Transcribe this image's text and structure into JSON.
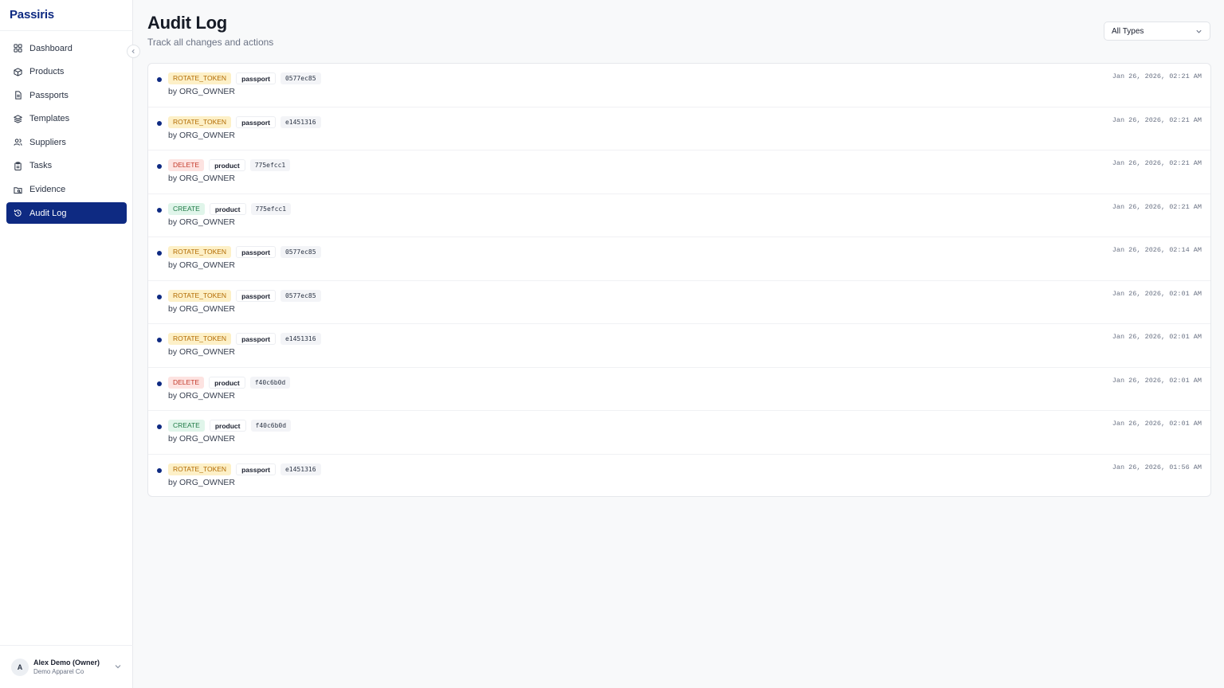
{
  "brand": {
    "logo": "Passiris"
  },
  "sidebar": {
    "items": [
      {
        "label": "Dashboard",
        "icon": "dashboard-icon",
        "active": false
      },
      {
        "label": "Products",
        "icon": "box-icon",
        "active": false
      },
      {
        "label": "Passports",
        "icon": "file-icon",
        "active": false
      },
      {
        "label": "Templates",
        "icon": "layers-icon",
        "active": false
      },
      {
        "label": "Suppliers",
        "icon": "users-icon",
        "active": false
      },
      {
        "label": "Tasks",
        "icon": "clipboard-icon",
        "active": false
      },
      {
        "label": "Evidence",
        "icon": "folder-icon",
        "active": false
      },
      {
        "label": "Audit Log",
        "icon": "history-icon",
        "active": true
      }
    ],
    "user": {
      "initial": "A",
      "name": "Alex Demo (Owner)",
      "org": "Demo Apparel Co"
    }
  },
  "header": {
    "title": "Audit Log",
    "subtitle": "Track all changes and actions",
    "filter": {
      "selected": "All Types"
    }
  },
  "colors": {
    "accent": "#0e2a82",
    "rotate_bg": "#fdf0c7",
    "delete_bg": "#fde3e1",
    "create_bg": "#e0f5ea"
  },
  "log": {
    "entries": [
      {
        "action": "ROTATE_TOKEN",
        "entity": "passport",
        "id": "0577ec85",
        "by": "by ORG_OWNER",
        "time": "Jan 26, 2026, 02:21 AM"
      },
      {
        "action": "ROTATE_TOKEN",
        "entity": "passport",
        "id": "e1451316",
        "by": "by ORG_OWNER",
        "time": "Jan 26, 2026, 02:21 AM"
      },
      {
        "action": "DELETE",
        "entity": "product",
        "id": "775efcc1",
        "by": "by ORG_OWNER",
        "time": "Jan 26, 2026, 02:21 AM"
      },
      {
        "action": "CREATE",
        "entity": "product",
        "id": "775efcc1",
        "by": "by ORG_OWNER",
        "time": "Jan 26, 2026, 02:21 AM"
      },
      {
        "action": "ROTATE_TOKEN",
        "entity": "passport",
        "id": "0577ec85",
        "by": "by ORG_OWNER",
        "time": "Jan 26, 2026, 02:14 AM"
      },
      {
        "action": "ROTATE_TOKEN",
        "entity": "passport",
        "id": "0577ec85",
        "by": "by ORG_OWNER",
        "time": "Jan 26, 2026, 02:01 AM"
      },
      {
        "action": "ROTATE_TOKEN",
        "entity": "passport",
        "id": "e1451316",
        "by": "by ORG_OWNER",
        "time": "Jan 26, 2026, 02:01 AM"
      },
      {
        "action": "DELETE",
        "entity": "product",
        "id": "f40c6b0d",
        "by": "by ORG_OWNER",
        "time": "Jan 26, 2026, 02:01 AM"
      },
      {
        "action": "CREATE",
        "entity": "product",
        "id": "f40c6b0d",
        "by": "by ORG_OWNER",
        "time": "Jan 26, 2026, 02:01 AM"
      },
      {
        "action": "ROTATE_TOKEN",
        "entity": "passport",
        "id": "e1451316",
        "by": "by ORG_OWNER",
        "time": "Jan 26, 2026, 01:56 AM"
      }
    ]
  }
}
